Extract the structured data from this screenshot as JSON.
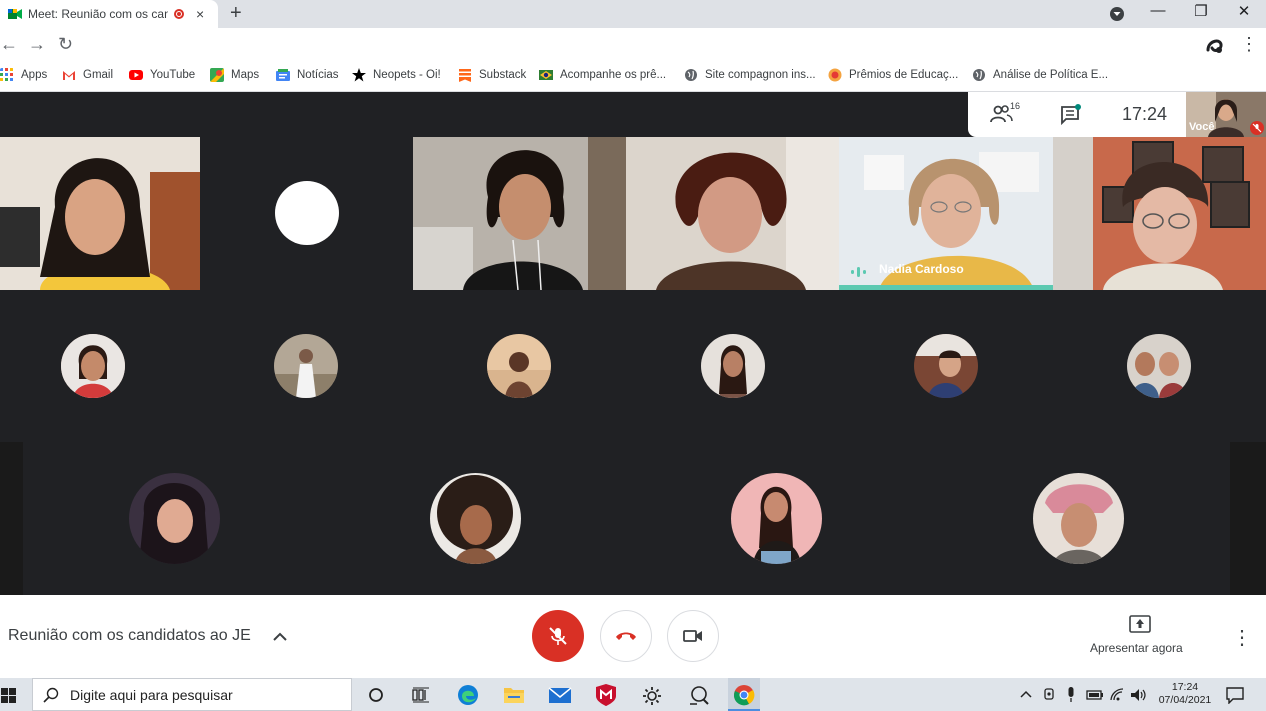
{
  "browser": {
    "tab_title": "Meet: Reunião com os cand",
    "tab_close": "×",
    "new_tab": "+",
    "win_minimize": "—",
    "win_restore": "❐",
    "win_close": "✕"
  },
  "toolbar": {
    "back": "←",
    "forward": "→",
    "reload": "↻",
    "menu": "⋮"
  },
  "bookmarks": [
    {
      "label": "Apps",
      "color": "#4285f4"
    },
    {
      "label": "Gmail",
      "color": "#ea4335"
    },
    {
      "label": "YouTube",
      "color": "#ff0000"
    },
    {
      "label": "Maps",
      "color": "#34a853"
    },
    {
      "label": "Notícias",
      "color": "#4285f4"
    },
    {
      "label": "Neopets - Oi!",
      "color": "#000000"
    },
    {
      "label": "Substack",
      "color": "#ff6719"
    },
    {
      "label": "Acompanhe os prê...",
      "color": "#2e7d32"
    },
    {
      "label": "Site compagnon ins...",
      "color": "#5f6368"
    },
    {
      "label": "Prêmios de Educaç...",
      "color": "#f4a340"
    },
    {
      "label": "Análise de Política E...",
      "color": "#5f6368"
    }
  ],
  "meet": {
    "participants_count": "16",
    "clock": "17:24",
    "self_label": "Você",
    "active_speaker": "Nadia Cardoso",
    "meeting_title": "Reunião com os candidatos ao JE",
    "present_label": "Apresentar agora"
  },
  "taskbar": {
    "search_placeholder": "Digite aqui para pesquisar",
    "time": "17:24",
    "date": "07/04/2021"
  },
  "colors": {
    "meet_bg": "#202124",
    "accent_red": "#d93025",
    "speaker_bar": "#5cc9b1"
  }
}
